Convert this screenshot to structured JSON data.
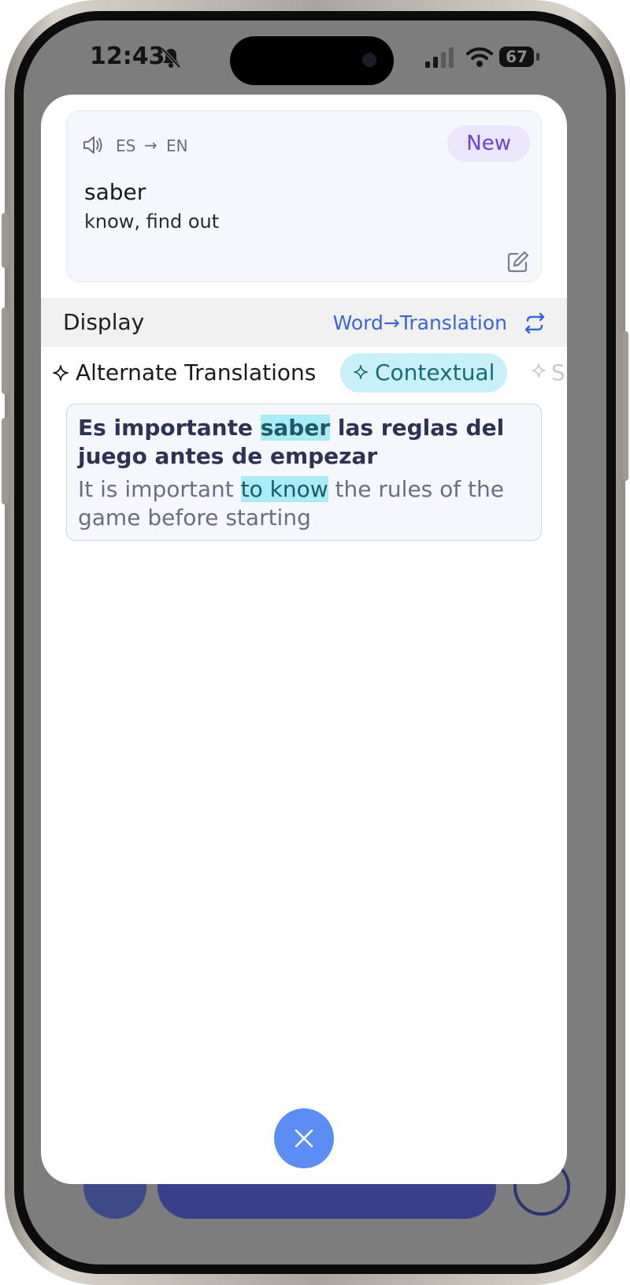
{
  "status_bar": {
    "time": "12:43",
    "battery": "67"
  },
  "card": {
    "lang_from": "ES",
    "lang_arrow": "→",
    "lang_to": "EN",
    "badge": "New",
    "word": "saber",
    "meaning": "know, find out"
  },
  "display": {
    "label": "Display",
    "mode": "Word→Translation"
  },
  "tabs": [
    {
      "label": "Alternate Translations"
    },
    {
      "label": "Contextual",
      "active": true
    },
    {
      "label": "S"
    }
  ],
  "example": {
    "sentence_before": "Es importante ",
    "sentence_highlight": "saber",
    "sentence_after": " las reglas del juego antes de empezar",
    "translation_before": "It is important ",
    "translation_highlight": "to know",
    "translation_after": " the rules of the game before starting"
  },
  "colors": {
    "accent": "#3b63dc",
    "badge_bg": "#ece6fc",
    "badge_text": "#6a40dc",
    "tab_active_bg": "#c8f0f8",
    "highlight": "#a8ecf5",
    "close_button": "#5b8df5"
  },
  "icons": [
    "bell-slash-icon",
    "speaker-icon",
    "edit-icon",
    "swap-icon",
    "sparkle-icon",
    "close-icon",
    "signal-icon",
    "wifi-icon",
    "battery-icon"
  ]
}
